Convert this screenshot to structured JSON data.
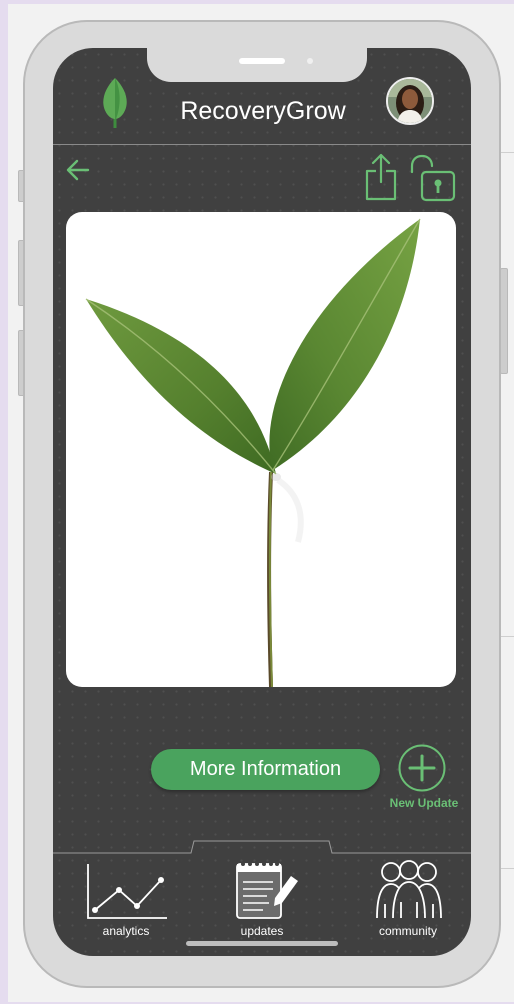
{
  "app": {
    "title": "RecoveryGrow"
  },
  "header": {
    "back_icon": "arrow-left-icon",
    "share_icon": "share-icon",
    "lock_icon": "unlock-icon",
    "avatar": "user-avatar"
  },
  "main": {
    "image": "plant-sprout-photo",
    "more_info_label": "More Information",
    "new_update_label": "New Update"
  },
  "nav": {
    "items": [
      {
        "label": "analytics",
        "icon": "analytics-chart-icon"
      },
      {
        "label": "updates",
        "icon": "notepad-pen-icon"
      },
      {
        "label": "community",
        "icon": "people-group-icon"
      }
    ],
    "active": "updates"
  },
  "colors": {
    "accent": "#4aa35e",
    "accent_light": "#6abf75",
    "screen": "#404040",
    "bezel": "#dadada"
  }
}
